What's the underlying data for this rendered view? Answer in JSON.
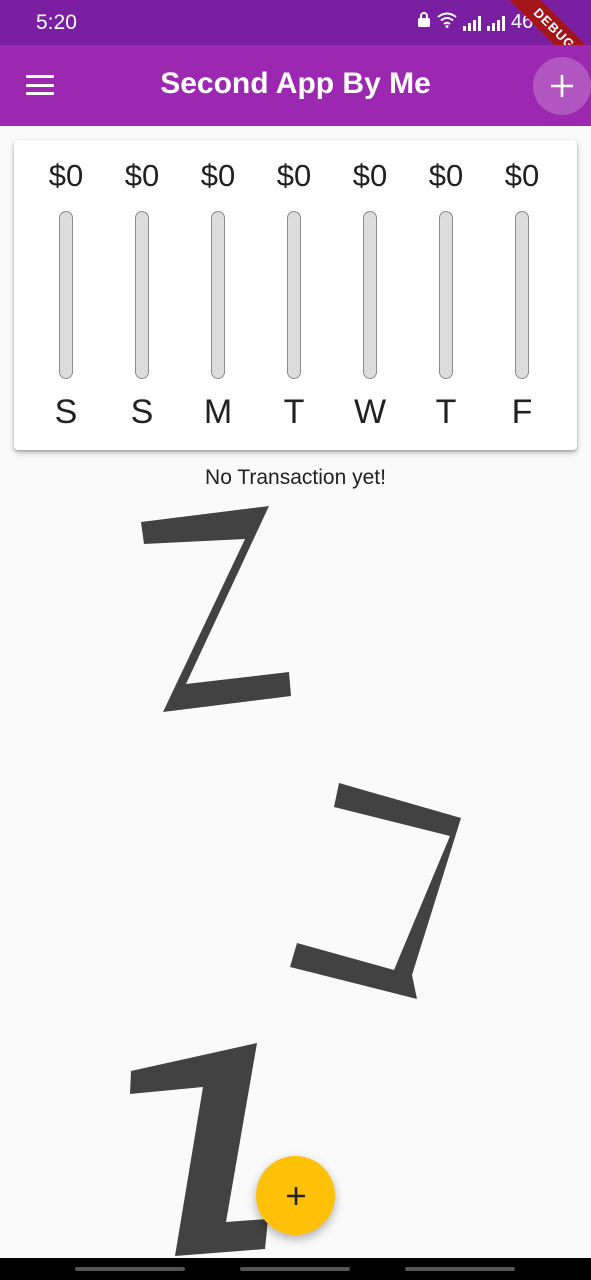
{
  "status_bar": {
    "time": "5:20",
    "battery": "46%"
  },
  "debug_banner": "DEBUG",
  "app_bar": {
    "title": "Second App By Me",
    "menu_icon": "menu-icon",
    "add_icon": "plus-icon"
  },
  "chart": {
    "bars": [
      {
        "day": "S",
        "amount": "$0",
        "fill": 0
      },
      {
        "day": "S",
        "amount": "$0",
        "fill": 0
      },
      {
        "day": "M",
        "amount": "$0",
        "fill": 0
      },
      {
        "day": "T",
        "amount": "$0",
        "fill": 0
      },
      {
        "day": "W",
        "amount": "$0",
        "fill": 0
      },
      {
        "day": "T",
        "amount": "$0",
        "fill": 0
      },
      {
        "day": "F",
        "amount": "$0",
        "fill": 0
      }
    ]
  },
  "empty_state": {
    "message": "No Transaction yet!",
    "illustration": "sleeping-zzz-image"
  },
  "fab": {
    "icon": "plus-icon"
  },
  "colors": {
    "primary": "#9c27b0",
    "status_bar": "#7b1fa2",
    "accent": "#ffc107",
    "zzz": "#424242"
  }
}
